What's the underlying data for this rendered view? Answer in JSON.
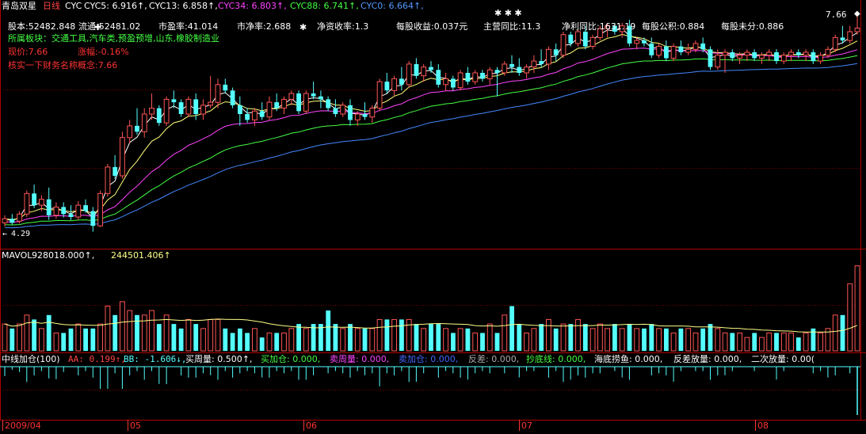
{
  "colors": {
    "bg": "#000000",
    "frame": "#b00000",
    "up": "#ff5555",
    "down": "#54ffff",
    "ma5": "#ffffff",
    "ma13": "#ffff77",
    "ma34": "#ff44ff",
    "ma88": "#44ff44",
    "ma0": "#4488ff",
    "vol_ma": "#ffff88",
    "green_text": "#44ff44",
    "red_text": "#ff3333",
    "white_text": "#ffffff"
  },
  "header": {
    "stock_name": "青岛双星",
    "period": "日线",
    "indicator": "CYC",
    "cyc5": "CYC5: 6.916↑,",
    "cyc13": "CYC13: 6.858↑,",
    "cyc34": "CYC34: 6.803↑,",
    "cyc88": "CYC88: 6.741↑,",
    "cyc0": "CYC0: 6.664↑,"
  },
  "info": {
    "total_shares": "股本:52482.848",
    "float_shares": "流通:52481.02",
    "pe": "市盈率:41.014",
    "pb": "市净率:2.688",
    "roe": "净资收率:1.3",
    "eps": "每股收益:0.037元",
    "rev_yoy": "主营同比:11.3",
    "profit_yoy": "净利同比:1631.19",
    "reserve": "每股公积:0.884",
    "undistributed": "每股未分:0.886",
    "sectors": "所属板块：交通工具,汽车类,预盈预增,山东,橡胶制造业",
    "price": "现价:7.66",
    "change": "涨幅:-0.16%",
    "concept": "核实一下财务名称概念:7.66"
  },
  "price_axis": {
    "high_label": "7.66",
    "low_label": "4.29",
    "low_prefix": "←",
    "ymin": 4.1,
    "ymax": 7.95
  },
  "volume_panel": {
    "title": "MAVOL",
    "v1": "928018.000↑,",
    "v2": "244501.406↑"
  },
  "indicator_panel": {
    "title": "中线加仓(100)",
    "aa": "AA: 0.199↑,",
    "bb": "BB: -1.606↓,",
    "buy_vol": "买周量: 0.500↑,",
    "add_pos": "买加仓: 0.000,",
    "sell_week": "卖周量: 0.000,",
    "sell_add": "卖加仓: 0.000,",
    "diff": "反差: 0.000,",
    "bottom_line": "抄底线: 0.000,",
    "sea_fish": "海底捞鱼: 0.000,",
    "diff_vol": "反差放量: 0.000,",
    "second_vol": "二次放量: 0.00("
  },
  "time_axis": [
    "2009/04",
    "05",
    "06",
    "07",
    "08"
  ],
  "chart_data": {
    "type": "candlestick",
    "title": "青岛双星 日线",
    "ylim": [
      4.1,
      7.95
    ],
    "markers": [
      "✚",
      "✱",
      "✱ ✱ ✱",
      "◆"
    ],
    "candles": [
      [
        4.35,
        4.48,
        4.29,
        4.42,
        3
      ],
      [
        4.42,
        4.5,
        4.32,
        4.35,
        2.5
      ],
      [
        4.38,
        4.55,
        4.34,
        4.5,
        3
      ],
      [
        4.5,
        4.9,
        4.45,
        4.85,
        4
      ],
      [
        4.85,
        5.0,
        4.6,
        4.65,
        3.5
      ],
      [
        4.65,
        4.82,
        4.55,
        4.75,
        2.5
      ],
      [
        4.75,
        4.95,
        4.4,
        4.48,
        4
      ],
      [
        4.48,
        4.7,
        4.42,
        4.62,
        2
      ],
      [
        4.62,
        4.7,
        4.44,
        4.5,
        2
      ],
      [
        4.5,
        4.65,
        4.4,
        4.45,
        2.5
      ],
      [
        4.45,
        4.72,
        4.4,
        4.65,
        3
      ],
      [
        4.65,
        4.75,
        4.52,
        4.55,
        2.5
      ],
      [
        4.55,
        4.62,
        4.2,
        4.3,
        2.5
      ],
      [
        4.3,
        4.9,
        4.28,
        4.85,
        3
      ],
      [
        4.85,
        5.35,
        4.8,
        5.3,
        5
      ],
      [
        5.3,
        5.5,
        5.1,
        5.15,
        4
      ],
      [
        5.15,
        5.9,
        5.1,
        5.8,
        5.5
      ],
      [
        5.8,
        6.1,
        5.7,
        6.0,
        4.5
      ],
      [
        6.0,
        6.3,
        5.85,
        5.9,
        4
      ],
      [
        5.9,
        6.3,
        5.8,
        6.2,
        4
      ],
      [
        6.2,
        6.55,
        6.1,
        6.3,
        4.5
      ],
      [
        6.3,
        6.35,
        6.0,
        6.05,
        3
      ],
      [
        6.05,
        6.5,
        6.0,
        6.45,
        4
      ],
      [
        6.45,
        6.6,
        6.3,
        6.4,
        3
      ],
      [
        6.4,
        6.45,
        6.15,
        6.2,
        2.5
      ],
      [
        6.2,
        6.5,
        6.15,
        6.45,
        3.5
      ],
      [
        6.45,
        6.55,
        6.1,
        6.2,
        3
      ],
      [
        6.2,
        6.45,
        6.1,
        6.35,
        2.5
      ],
      [
        6.35,
        6.85,
        6.3,
        6.4,
        3.5
      ],
      [
        6.4,
        6.8,
        6.3,
        6.7,
        3.5
      ],
      [
        6.7,
        6.8,
        6.55,
        6.6,
        2.5
      ],
      [
        6.6,
        6.65,
        6.3,
        6.35,
        2
      ],
      [
        6.35,
        6.5,
        6.0,
        6.2,
        2.5
      ],
      [
        6.2,
        6.3,
        6.05,
        6.1,
        2
      ],
      [
        6.1,
        6.3,
        6.0,
        6.25,
        2.5
      ],
      [
        6.25,
        6.4,
        6.1,
        6.15,
        1.5
      ],
      [
        6.15,
        6.5,
        6.1,
        6.4,
        2
      ],
      [
        6.4,
        6.55,
        6.25,
        6.3,
        2
      ],
      [
        6.3,
        6.5,
        6.2,
        6.45,
        2
      ],
      [
        6.45,
        6.6,
        6.35,
        6.55,
        2.5
      ],
      [
        6.55,
        6.6,
        6.2,
        6.25,
        3
      ],
      [
        6.25,
        6.6,
        6.2,
        6.55,
        2.5
      ],
      [
        6.55,
        6.75,
        6.45,
        6.5,
        3
      ],
      [
        6.5,
        6.6,
        6.3,
        6.45,
        3
      ],
      [
        6.45,
        6.5,
        6.25,
        6.3,
        4.5
      ],
      [
        6.3,
        6.45,
        6.15,
        6.2,
        3
      ],
      [
        6.2,
        6.4,
        6.15,
        6.35,
        2.5
      ],
      [
        6.35,
        6.45,
        6.0,
        6.1,
        3
      ],
      [
        6.1,
        6.25,
        6.0,
        6.2,
        2.5
      ],
      [
        6.2,
        6.4,
        6.1,
        6.15,
        2.5
      ],
      [
        6.15,
        6.35,
        6.05,
        6.3,
        2.5
      ],
      [
        6.3,
        6.8,
        6.25,
        6.75,
        3.5
      ],
      [
        6.75,
        6.9,
        6.55,
        6.6,
        3.5
      ],
      [
        6.6,
        6.85,
        6.5,
        6.8,
        3.5
      ],
      [
        6.8,
        7.0,
        6.6,
        6.7,
        3.5
      ],
      [
        6.7,
        7.1,
        6.65,
        7.05,
        3.5
      ],
      [
        7.05,
        7.15,
        6.8,
        6.85,
        3
      ],
      [
        6.85,
        7.05,
        6.75,
        7.0,
        2.5
      ],
      [
        7.0,
        7.1,
        6.9,
        6.95,
        3
      ],
      [
        6.95,
        7.05,
        6.65,
        6.7,
        3
      ],
      [
        6.7,
        6.9,
        6.6,
        6.8,
        2.5
      ],
      [
        6.8,
        6.85,
        6.6,
        6.65,
        2
      ],
      [
        6.65,
        6.95,
        6.6,
        6.9,
        2.5
      ],
      [
        6.9,
        7.0,
        6.7,
        6.75,
        2.5
      ],
      [
        6.75,
        6.95,
        6.7,
        6.9,
        2
      ],
      [
        6.9,
        6.95,
        6.75,
        6.8,
        2
      ],
      [
        6.8,
        7.0,
        6.7,
        6.95,
        3
      ],
      [
        6.95,
        7.0,
        6.5,
        6.9,
        2
      ],
      [
        6.9,
        7.1,
        6.85,
        7.05,
        4
      ],
      [
        7.05,
        7.2,
        6.9,
        7.0,
        5
      ],
      [
        7.0,
        7.15,
        6.85,
        6.9,
        3
      ],
      [
        6.9,
        7.05,
        6.8,
        7.0,
        2
      ],
      [
        7.0,
        7.2,
        6.9,
        7.1,
        2.5
      ],
      [
        7.1,
        7.3,
        7.0,
        7.05,
        3
      ],
      [
        7.05,
        7.35,
        6.95,
        7.3,
        3.5
      ],
      [
        7.3,
        7.4,
        7.1,
        7.2,
        2.5
      ],
      [
        7.2,
        7.6,
        7.15,
        7.55,
        3
      ],
      [
        7.55,
        7.6,
        7.35,
        7.4,
        3
      ],
      [
        7.4,
        7.65,
        7.35,
        7.6,
        3.5
      ],
      [
        7.6,
        7.7,
        7.3,
        7.35,
        3
      ],
      [
        7.35,
        7.55,
        7.3,
        7.5,
        2.5
      ],
      [
        7.5,
        7.7,
        7.45,
        7.65,
        3
      ],
      [
        7.65,
        7.75,
        7.5,
        7.7,
        2.5
      ],
      [
        7.7,
        7.75,
        7.55,
        7.6,
        3
      ],
      [
        7.6,
        7.75,
        7.5,
        7.7,
        2.5
      ],
      [
        7.7,
        7.8,
        7.35,
        7.4,
        3
      ],
      [
        7.4,
        7.5,
        7.3,
        7.45,
        2.5
      ],
      [
        7.45,
        7.5,
        7.35,
        7.4,
        2.5
      ],
      [
        7.4,
        7.5,
        7.15,
        7.2,
        3
      ],
      [
        7.2,
        7.4,
        7.15,
        7.35,
        2.5
      ],
      [
        7.35,
        7.45,
        7.1,
        7.15,
        2.5
      ],
      [
        7.15,
        7.4,
        7.1,
        7.35,
        2
      ],
      [
        7.35,
        7.45,
        7.2,
        7.25,
        2.5
      ],
      [
        7.25,
        7.4,
        7.2,
        7.3,
        2.5
      ],
      [
        7.3,
        7.45,
        7.25,
        7.4,
        2
      ],
      [
        7.4,
        7.5,
        7.25,
        7.3,
        2.5
      ],
      [
        7.3,
        7.35,
        6.95,
        7.0,
        3
      ],
      [
        7.0,
        7.3,
        6.95,
        7.2,
        2.5
      ],
      [
        7.2,
        7.3,
        6.9,
        7.25,
        2
      ],
      [
        7.25,
        7.3,
        7.1,
        7.15,
        2
      ],
      [
        7.15,
        7.25,
        7.05,
        7.2,
        2
      ],
      [
        7.2,
        7.3,
        7.1,
        7.25,
        1.5
      ],
      [
        7.25,
        7.3,
        7.1,
        7.15,
        2
      ],
      [
        7.15,
        7.25,
        7.05,
        7.2,
        1.5
      ],
      [
        7.2,
        7.3,
        7.1,
        7.25,
        2
      ],
      [
        7.25,
        7.3,
        7.05,
        7.1,
        2
      ],
      [
        7.1,
        7.25,
        7.05,
        7.2,
        2
      ],
      [
        7.2,
        7.3,
        7.1,
        7.25,
        2
      ],
      [
        7.25,
        7.3,
        7.15,
        7.2,
        1.5
      ],
      [
        7.2,
        7.3,
        7.1,
        7.25,
        2
      ],
      [
        7.25,
        7.3,
        7.05,
        7.1,
        2.5
      ],
      [
        7.1,
        7.25,
        7.05,
        7.2,
        2
      ],
      [
        7.2,
        7.35,
        7.15,
        7.3,
        2.5
      ],
      [
        7.3,
        7.55,
        7.25,
        7.5,
        4
      ],
      [
        7.5,
        7.7,
        7.4,
        7.45,
        4
      ],
      [
        7.45,
        7.7,
        7.4,
        7.6,
        7.5
      ],
      [
        7.6,
        7.95,
        7.55,
        7.66,
        9.5
      ]
    ]
  }
}
